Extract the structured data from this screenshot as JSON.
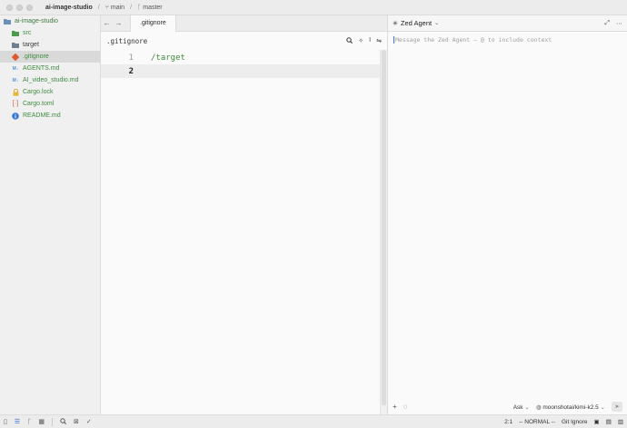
{
  "titlebar": {
    "project": "ai-image-studio",
    "branch_icon": "branch-icon",
    "branch": "main",
    "remote_branch": "master"
  },
  "sidebar": {
    "root": "ai-image-studio",
    "items": [
      {
        "label": "src",
        "icon": "folder-icon"
      },
      {
        "label": "target",
        "icon": "folder-icon"
      },
      {
        "label": ".gitignore",
        "icon": "git-icon"
      },
      {
        "label": "AGENTS.md",
        "icon": "markdown-icon"
      },
      {
        "label": "AI_video_studio.md",
        "icon": "markdown-icon"
      },
      {
        "label": "Cargo.lock",
        "icon": "lock-icon"
      },
      {
        "label": "Cargo.toml",
        "icon": "toml-icon"
      },
      {
        "label": "README.md",
        "icon": "info-icon"
      }
    ]
  },
  "editor": {
    "tab_label": ".gitignore",
    "breadcrumb": ".gitignore",
    "lines": [
      {
        "num": "1",
        "code": "/target"
      },
      {
        "num": "2",
        "code": ""
      }
    ]
  },
  "agent": {
    "title": "Zed Agent",
    "placeholder": "Message the Zed Agent — @ to include context",
    "mode": "Ask",
    "model": "moonshotai/kimi-k2.5"
  },
  "statusbar": {
    "position": "2:1",
    "vim_mode": "-- NORMAL --",
    "language": "Git Ignore"
  },
  "colors": {
    "accent": "#3b6fd6",
    "string_green": "#3f8a3f"
  }
}
